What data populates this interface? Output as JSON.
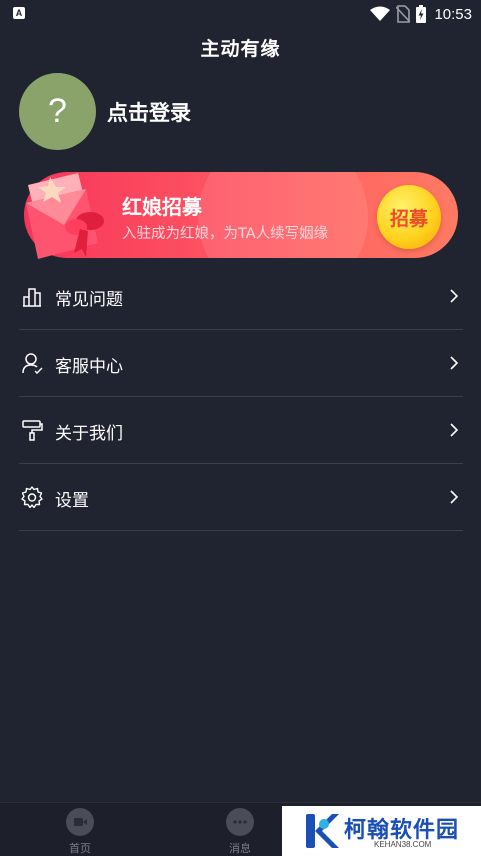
{
  "status_bar": {
    "left_icon": "A",
    "time": "10:53",
    "icons": [
      "wifi-icon",
      "no-sim-icon",
      "battery-charging-icon"
    ]
  },
  "header": {
    "title": "主动有缘"
  },
  "profile": {
    "avatar_placeholder": "?",
    "login_label": "点击登录"
  },
  "banner": {
    "title": "红娘招募",
    "subtitle": "入驻成为红娘，为TA人续写姻缘",
    "badge_label": "招募",
    "gradient_start": "#f7355b",
    "gradient_end": "#ff7a63"
  },
  "menu": {
    "items": [
      {
        "label": "常见问题",
        "icon": "bar-chart-icon"
      },
      {
        "label": "客服中心",
        "icon": "user-service-icon"
      },
      {
        "label": "关于我们",
        "icon": "paint-roller-icon"
      },
      {
        "label": "设置",
        "icon": "gear-icon"
      }
    ]
  },
  "bottom_nav": {
    "items": [
      {
        "label": "首页",
        "icon": "video-icon"
      },
      {
        "label": "消息",
        "icon": "chat-icon"
      }
    ]
  },
  "watermark": {
    "name": "柯翰软件园",
    "domain": "KEHAN38.COM",
    "color": "#1a4fb5"
  }
}
